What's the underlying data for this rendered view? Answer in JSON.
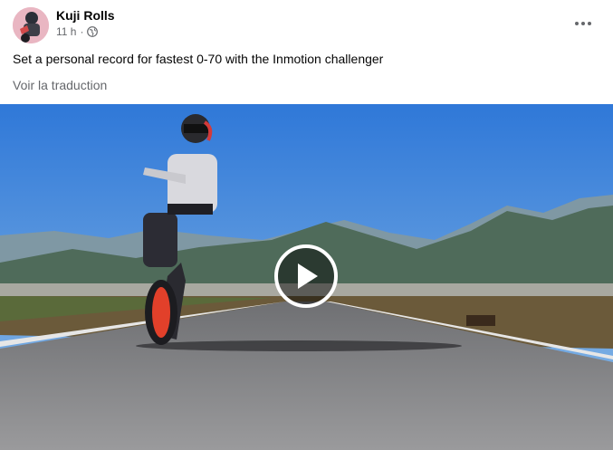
{
  "post": {
    "author": "Kuji Rolls",
    "time": "11 h",
    "separator": "·",
    "privacy_icon": "globe-icon",
    "more_icon": "more-options-icon",
    "text": "Set a personal record for fastest 0-70 with the Inmotion challenger",
    "translate_label": "Voir la traduction"
  },
  "video": {
    "play_icon": "play-icon",
    "colors": {
      "sky": "#3b7fd6",
      "road": "#8a8a8c",
      "mountains": "#4f6b5a",
      "field": "#6b5a3a",
      "wheel_accent": "#e2402a"
    }
  }
}
